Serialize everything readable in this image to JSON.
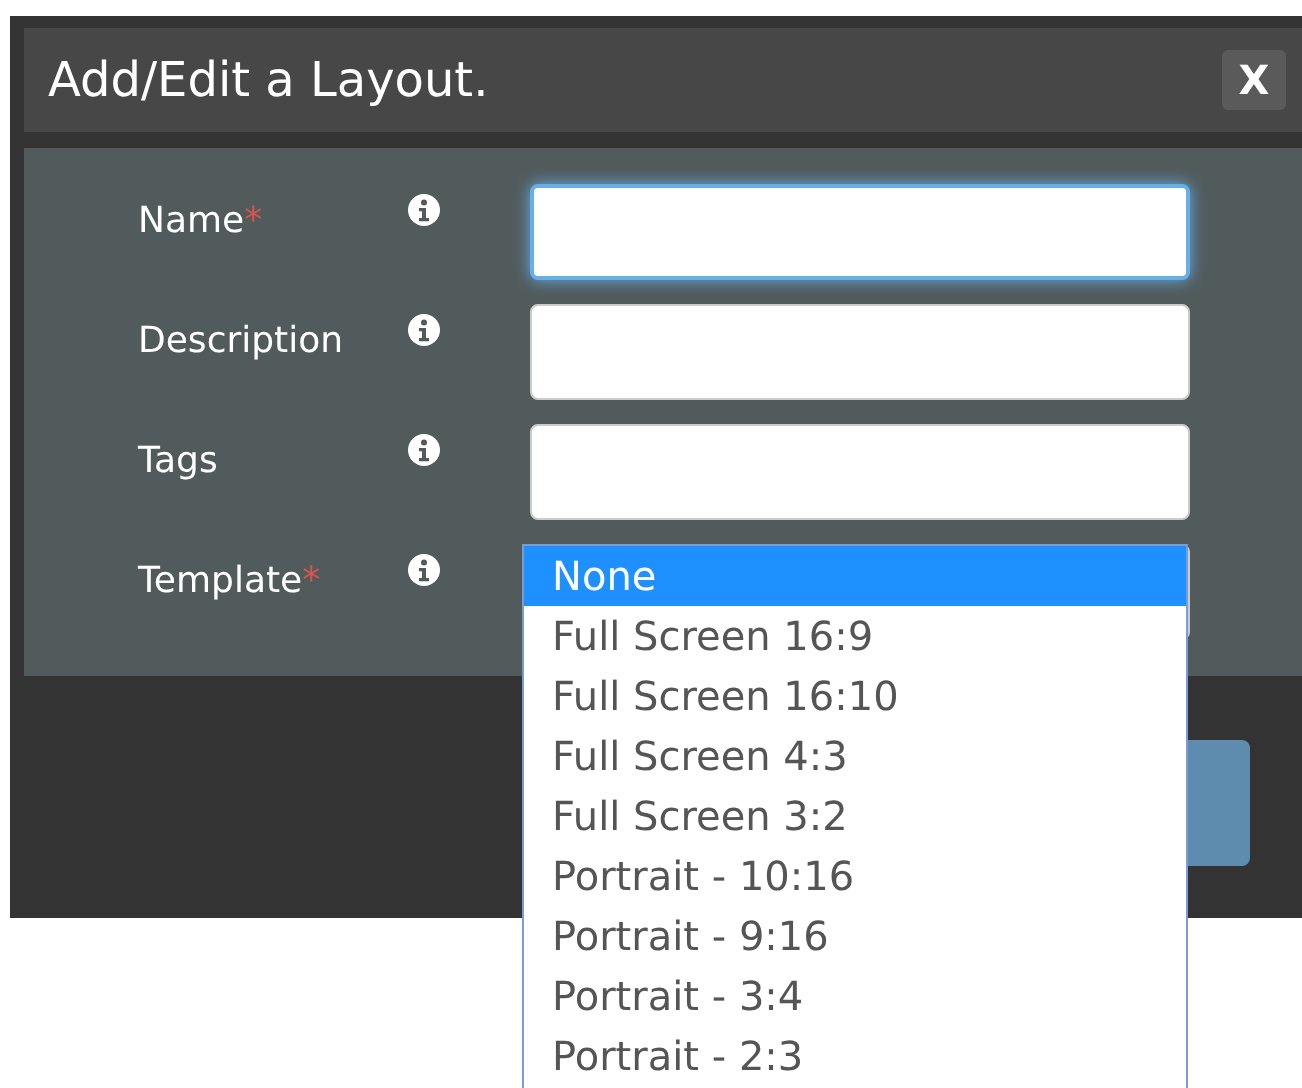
{
  "dialog": {
    "title": "Add/Edit a Layout.",
    "close": "X"
  },
  "fields": [
    {
      "label": "Name",
      "required_mark": "*",
      "focused": true,
      "kind": "text"
    },
    {
      "label": "Description",
      "focused": false,
      "kind": "text"
    },
    {
      "label": "Tags",
      "focused": false,
      "kind": "text"
    },
    {
      "label": "Template",
      "required_mark": "*",
      "focused": false,
      "kind": "select",
      "options": [
        {
          "label": "None",
          "selected": true
        },
        {
          "label": "Full Screen 16:9",
          "selected": false
        },
        {
          "label": "Full Screen 16:10",
          "selected": false
        },
        {
          "label": "Full Screen 4:3",
          "selected": false
        },
        {
          "label": "Full Screen 3:2",
          "selected": false
        },
        {
          "label": "Portrait - 10:16",
          "selected": false
        },
        {
          "label": "Portrait - 9:16",
          "selected": false
        },
        {
          "label": "Portrait - 3:4",
          "selected": false
        },
        {
          "label": "Portrait - 2:3",
          "selected": false
        }
      ]
    }
  ]
}
